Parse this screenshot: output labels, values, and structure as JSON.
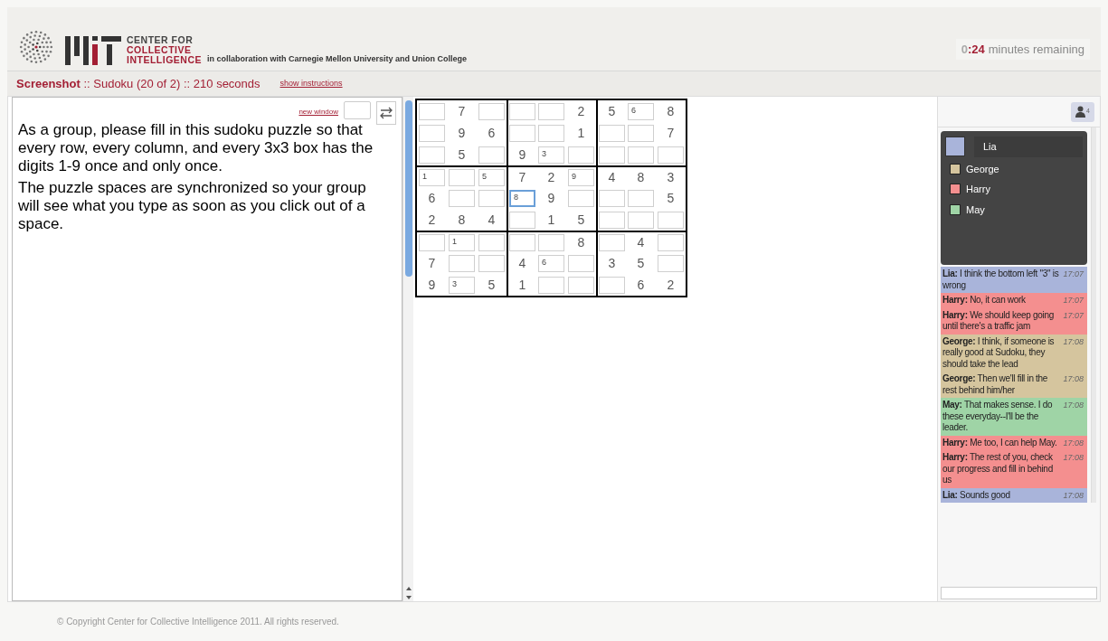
{
  "header": {
    "logo_lines": [
      "CENTER FOR",
      "COLLECTIVE",
      "INTELLIGENCE"
    ],
    "collaboration": "in collaboration with Carnegie Mellon University and Union College",
    "timer": {
      "hours": "0",
      "minutes": ":24",
      "label": "minutes remaining"
    }
  },
  "title_bar": {
    "title": "**Screenshot** :: Sudoku (20 of 2) :: 210 seconds",
    "link": "show instructions"
  },
  "instructions": {
    "new_window_link": "new window",
    "paragraphs": [
      "As a group, please fill in this sudoku puzzle so that every row, every column, and every 3x3 box has the digits 1-9 once and only once.",
      "The puzzle spaces are synchronized so your group will see what you type as soon as you click out of a space."
    ]
  },
  "sudoku": [
    [
      {
        "kind": "input",
        "focused": false
      },
      {
        "kind": "given",
        "value": "7"
      },
      {
        "kind": "input",
        "focused": false
      },
      {
        "kind": "input",
        "focused": false
      },
      {
        "kind": "input",
        "focused": false
      },
      {
        "kind": "given",
        "value": "2"
      },
      {
        "kind": "given",
        "value": "5"
      },
      {
        "kind": "input",
        "value": "6",
        "focused": false
      },
      {
        "kind": "given",
        "value": "8"
      }
    ],
    [
      {
        "kind": "input",
        "focused": false
      },
      {
        "kind": "given",
        "value": "9"
      },
      {
        "kind": "given",
        "value": "6"
      },
      {
        "kind": "input",
        "focused": false
      },
      {
        "kind": "input",
        "focused": false
      },
      {
        "kind": "given",
        "value": "1"
      },
      {
        "kind": "input",
        "focused": false
      },
      {
        "kind": "input",
        "focused": false
      },
      {
        "kind": "given",
        "value": "7"
      }
    ],
    [
      {
        "kind": "input",
        "focused": false
      },
      {
        "kind": "given",
        "value": "5"
      },
      {
        "kind": "input",
        "focused": false
      },
      {
        "kind": "given",
        "value": "9"
      },
      {
        "kind": "input",
        "value": "3",
        "focused": false
      },
      {
        "kind": "input",
        "focused": false
      },
      {
        "kind": "input",
        "focused": false
      },
      {
        "kind": "input",
        "focused": false
      },
      {
        "kind": "input",
        "focused": false
      }
    ],
    [
      {
        "kind": "input",
        "value": "1",
        "focused": false
      },
      {
        "kind": "input",
        "focused": false
      },
      {
        "kind": "input",
        "value": "5",
        "focused": false
      },
      {
        "kind": "given",
        "value": "7"
      },
      {
        "kind": "given",
        "value": "2"
      },
      {
        "kind": "input",
        "value": "9",
        "focused": false
      },
      {
        "kind": "given",
        "value": "4"
      },
      {
        "kind": "given",
        "value": "8"
      },
      {
        "kind": "given",
        "value": "3"
      }
    ],
    [
      {
        "kind": "given",
        "value": "6"
      },
      {
        "kind": "input",
        "focused": false
      },
      {
        "kind": "input",
        "focused": false
      },
      {
        "kind": "input",
        "value": "8",
        "focused": true
      },
      {
        "kind": "given",
        "value": "9"
      },
      {
        "kind": "input",
        "focused": false
      },
      {
        "kind": "input",
        "focused": false
      },
      {
        "kind": "input",
        "focused": false
      },
      {
        "kind": "given",
        "value": "5"
      }
    ],
    [
      {
        "kind": "given",
        "value": "2"
      },
      {
        "kind": "given",
        "value": "8"
      },
      {
        "kind": "given",
        "value": "4"
      },
      {
        "kind": "input",
        "focused": false
      },
      {
        "kind": "given",
        "value": "1"
      },
      {
        "kind": "given",
        "value": "5"
      },
      {
        "kind": "input",
        "focused": false
      },
      {
        "kind": "input",
        "focused": false
      },
      {
        "kind": "input",
        "focused": false
      }
    ],
    [
      {
        "kind": "input",
        "focused": false
      },
      {
        "kind": "input",
        "value": "1",
        "focused": false
      },
      {
        "kind": "input",
        "focused": false
      },
      {
        "kind": "input",
        "focused": false
      },
      {
        "kind": "input",
        "focused": false
      },
      {
        "kind": "given",
        "value": "8"
      },
      {
        "kind": "input",
        "focused": false
      },
      {
        "kind": "given",
        "value": "4"
      },
      {
        "kind": "input",
        "focused": false
      }
    ],
    [
      {
        "kind": "given",
        "value": "7"
      },
      {
        "kind": "input",
        "focused": false
      },
      {
        "kind": "input",
        "focused": false
      },
      {
        "kind": "given",
        "value": "4"
      },
      {
        "kind": "input",
        "value": "6",
        "focused": false
      },
      {
        "kind": "input",
        "focused": false
      },
      {
        "kind": "given",
        "value": "3"
      },
      {
        "kind": "given",
        "value": "5"
      },
      {
        "kind": "input",
        "focused": false
      }
    ],
    [
      {
        "kind": "given",
        "value": "9"
      },
      {
        "kind": "input",
        "value": "3",
        "focused": false
      },
      {
        "kind": "given",
        "value": "5"
      },
      {
        "kind": "given",
        "value": "1"
      },
      {
        "kind": "input",
        "focused": false
      },
      {
        "kind": "input",
        "focused": false
      },
      {
        "kind": "input",
        "focused": false
      },
      {
        "kind": "given",
        "value": "6"
      },
      {
        "kind": "given",
        "value": "2"
      }
    ]
  ],
  "users_button": {
    "count": "4"
  },
  "users": [
    {
      "name": "Lia",
      "color": "#a9b4da",
      "selected": true
    },
    {
      "name": "George",
      "color": "#d5c59e",
      "selected": false
    },
    {
      "name": "Harry",
      "color": "#f48f8f",
      "selected": false
    },
    {
      "name": "May",
      "color": "#9fd4a6",
      "selected": false
    }
  ],
  "chat": [
    {
      "text": "**Lia:** I think the bottom left \"3\" is wrong",
      "time": "17:07",
      "color": "#a9b4da"
    },
    {
      "text": "**Harry:** No, it can work",
      "time": "17:07",
      "color": "#f48f8f"
    },
    {
      "text": "**Harry:** We should keep going until there's a traffic jam",
      "time": "17:07",
      "color": "#f48f8f"
    },
    {
      "text": "**George:** I think, if someone is really good at Sudoku, they should take the lead",
      "time": "17:08",
      "color": "#d5c59e"
    },
    {
      "text": "**George:** Then we'll fill in the rest behind him/her",
      "time": "17:08",
      "color": "#d5c59e"
    },
    {
      "text": "**May:** That makes sense. I do these everyday--I'll be the leader.",
      "time": "17:08",
      "color": "#9fd4a6"
    },
    {
      "text": "**Harry:** Me too, I can help May.",
      "time": "17:08",
      "color": "#f48f8f"
    },
    {
      "text": "**Harry:** The rest of you, check our progress and fill in behind us",
      "time": "17:08",
      "color": "#f48f8f"
    },
    {
      "text": "**Lia:** Sounds good",
      "time": "17:08",
      "color": "#a9b4da"
    }
  ],
  "footer": "© Copyright Center for Collective Intelligence 2011. All rights reserved."
}
